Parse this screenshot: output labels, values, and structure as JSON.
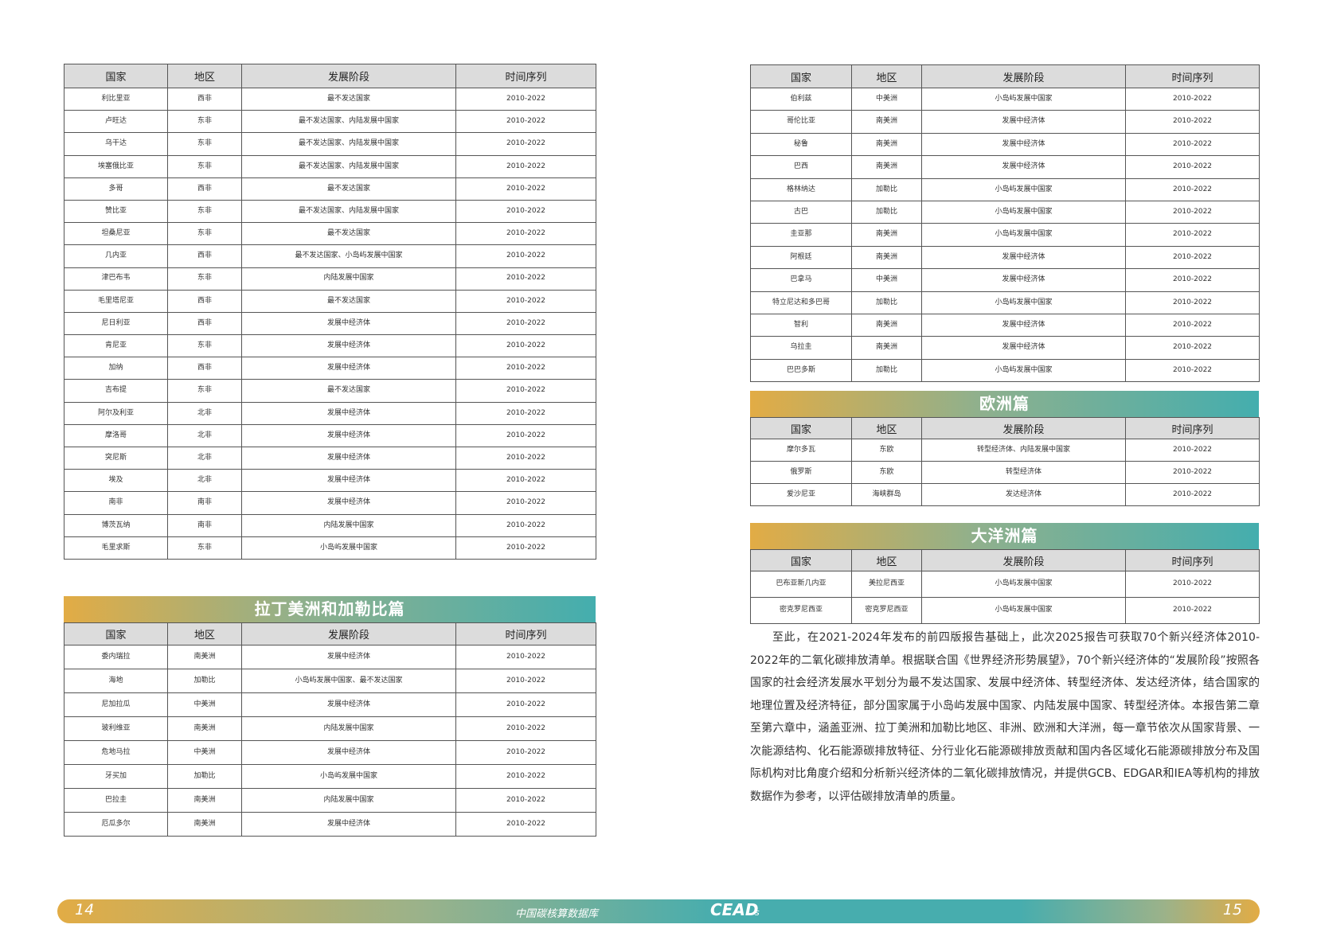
{
  "headers": [
    "国家",
    "地区",
    "发展阶段",
    "时间序列"
  ],
  "africa_rows": [
    [
      "利比里亚",
      "西非",
      "最不发达国家",
      "2010-2022"
    ],
    [
      "卢旺达",
      "东非",
      "最不发达国家、内陆发展中国家",
      "2010-2022"
    ],
    [
      "乌干达",
      "东非",
      "最不发达国家、内陆发展中国家",
      "2010-2022"
    ],
    [
      "埃塞俄比亚",
      "东非",
      "最不发达国家、内陆发展中国家",
      "2010-2022"
    ],
    [
      "多哥",
      "西非",
      "最不发达国家",
      "2010-2022"
    ],
    [
      "赞比亚",
      "东非",
      "最不发达国家、内陆发展中国家",
      "2010-2022"
    ],
    [
      "坦桑尼亚",
      "东非",
      "最不发达国家",
      "2010-2022"
    ],
    [
      "几内亚",
      "西非",
      "最不发达国家、小岛屿发展中国家",
      "2010-2022"
    ],
    [
      "津巴布韦",
      "东非",
      "内陆发展中国家",
      "2010-2022"
    ],
    [
      "毛里塔尼亚",
      "西非",
      "最不发达国家",
      "2010-2022"
    ],
    [
      "尼日利亚",
      "西非",
      "发展中经济体",
      "2010-2022"
    ],
    [
      "肯尼亚",
      "东非",
      "发展中经济体",
      "2010-2022"
    ],
    [
      "加纳",
      "西非",
      "发展中经济体",
      "2010-2022"
    ],
    [
      "吉布提",
      "东非",
      "最不发达国家",
      "2010-2022"
    ],
    [
      "阿尔及利亚",
      "北非",
      "发展中经济体",
      "2010-2022"
    ],
    [
      "摩洛哥",
      "北非",
      "发展中经济体",
      "2010-2022"
    ],
    [
      "突尼斯",
      "北非",
      "发展中经济体",
      "2010-2022"
    ],
    [
      "埃及",
      "北非",
      "发展中经济体",
      "2010-2022"
    ],
    [
      "南非",
      "南非",
      "发展中经济体",
      "2010-2022"
    ],
    [
      "博茨瓦纳",
      "南非",
      "内陆发展中国家",
      "2010-2022"
    ],
    [
      "毛里求斯",
      "东非",
      "小岛屿发展中国家",
      "2010-2022"
    ]
  ],
  "latam_title": "拉丁美洲和加勒比篇",
  "latam_rows": [
    [
      "委内瑞拉",
      "南美洲",
      "发展中经济体",
      "2010-2022"
    ],
    [
      "海地",
      "加勒比",
      "小岛屿发展中国家、最不发达国家",
      "2010-2022"
    ],
    [
      "尼加拉瓜",
      "中美洲",
      "发展中经济体",
      "2010-2022"
    ],
    [
      "玻利维亚",
      "南美洲",
      "内陆发展中国家",
      "2010-2022"
    ],
    [
      "危地马拉",
      "中美洲",
      "发展中经济体",
      "2010-2022"
    ],
    [
      "牙买加",
      "加勒比",
      "小岛屿发展中国家",
      "2010-2022"
    ],
    [
      "巴拉圭",
      "南美洲",
      "内陆发展中国家",
      "2010-2022"
    ],
    [
      "厄瓜多尔",
      "南美洲",
      "发展中经济体",
      "2010-2022"
    ]
  ],
  "latam_cont_rows": [
    [
      "伯利兹",
      "中美洲",
      "小岛屿发展中国家",
      "2010-2022"
    ],
    [
      "哥伦比亚",
      "南美洲",
      "发展中经济体",
      "2010-2022"
    ],
    [
      "秘鲁",
      "南美洲",
      "发展中经济体",
      "2010-2022"
    ],
    [
      "巴西",
      "南美洲",
      "发展中经济体",
      "2010-2022"
    ],
    [
      "格林纳达",
      "加勒比",
      "小岛屿发展中国家",
      "2010-2022"
    ],
    [
      "古巴",
      "加勒比",
      "小岛屿发展中国家",
      "2010-2022"
    ],
    [
      "圭亚那",
      "南美洲",
      "小岛屿发展中国家",
      "2010-2022"
    ],
    [
      "阿根廷",
      "南美洲",
      "发展中经济体",
      "2010-2022"
    ],
    [
      "巴拿马",
      "中美洲",
      "发展中经济体",
      "2010-2022"
    ],
    [
      "特立尼达和多巴哥",
      "加勒比",
      "小岛屿发展中国家",
      "2010-2022"
    ],
    [
      "智利",
      "南美洲",
      "发展中经济体",
      "2010-2022"
    ],
    [
      "乌拉圭",
      "南美洲",
      "发展中经济体",
      "2010-2022"
    ],
    [
      "巴巴多斯",
      "加勒比",
      "小岛屿发展中国家",
      "2010-2022"
    ]
  ],
  "europe_title": "欧洲篇",
  "europe_rows": [
    [
      "摩尔多瓦",
      "东欧",
      "转型经济体、内陆发展中国家",
      "2010-2022"
    ],
    [
      "俄罗斯",
      "东欧",
      "转型经济体",
      "2010-2022"
    ],
    [
      "爱沙尼亚",
      "海峡群岛",
      "发达经济体",
      "2010-2022"
    ]
  ],
  "oceania_title": "大洋洲篇",
  "oceania_rows": [
    [
      "巴布亚新几内亚",
      "美拉尼西亚",
      "小岛屿发展中国家",
      "2010-2022"
    ],
    [
      "密克罗尼西亚",
      "密克罗尼西亚",
      "小岛屿发展中国家",
      "2010-2022"
    ]
  ],
  "paragraph": "至此，在2021-2024年发布的前四版报告基础上，此次2025报告可获取70个新兴经济体2010-2022年的二氧化碳排放清单。根据联合国《世界经济形势展望》，70个新兴经济体的“发展阶段”按照各国家的社会经济发展水平划分为最不发达国家、发展中经济体、转型经济体、发达经济体，结合国家的地理位置及经济特征，部分国家属于小岛屿发展中国家、内陆发展中国家、转型经济体。本报告第二章至第六章中，涵盖亚洲、拉丁美洲和加勒比地区、非洲、欧洲和大洋洲，每一章节依次从国家背景、一次能源结构、化石能源碳排放特征、分行业化石能源碳排放贡献和国内各区域化石能源碳排放分布及国际机构对比角度介绍和分析新兴经济体的二氧化碳排放情况，并提供GCB、EDGAR和IEA等机构的排放数据作为参考，以评估碳排放清单的质量。",
  "footer": {
    "page_left": "14",
    "page_right": "15",
    "database": "中国碳核算数据库",
    "logo": "CEAD",
    "logo_suffix": "s"
  },
  "colors": {
    "gradient_start": "#e2ac45",
    "gradient_end": "#44aeae",
    "header_fill": "#dcdcdc"
  }
}
